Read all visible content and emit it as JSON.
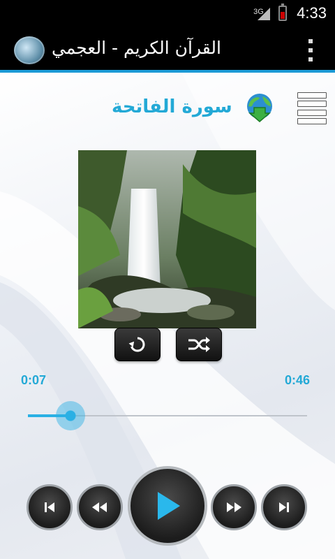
{
  "status_bar": {
    "network_type": "3G",
    "time": "4:33",
    "battery_color": "#cc0000"
  },
  "action_bar": {
    "title": "القرآن الكريم - العجمي",
    "logo_icon": "app-logo",
    "menu_icon": "overflow-menu-icon",
    "accent_color": "#1c9ad6"
  },
  "player": {
    "surah_title": "سورة الفاتحة",
    "download_icon": "globe-download-icon",
    "playlist_icon": "list-menu-icon",
    "elapsed": "0:07",
    "total": "0:46",
    "progress_fraction": 0.152,
    "accent_color": "#23a9d6"
  },
  "controls": {
    "repeat_icon": "repeat-icon",
    "shuffle_icon": "shuffle-icon",
    "prev_icon": "skip-previous-icon",
    "rewind_icon": "rewind-icon",
    "play_icon": "play-icon",
    "forward_icon": "fast-forward-icon",
    "next_icon": "skip-next-icon"
  }
}
